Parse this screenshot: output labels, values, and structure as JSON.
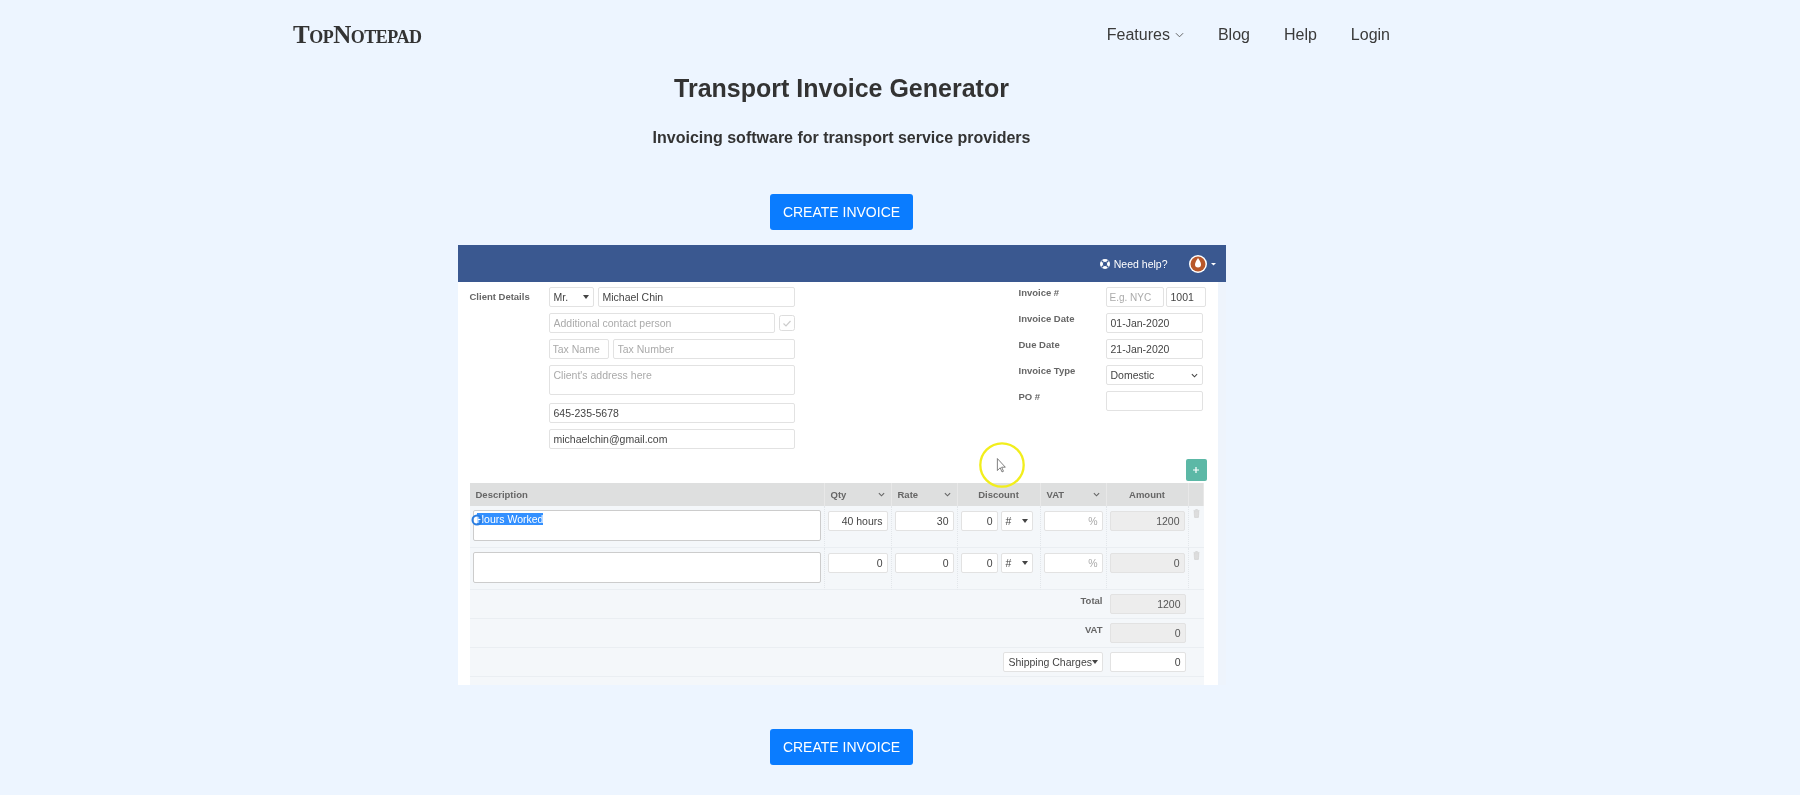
{
  "nav": {
    "logo": "TopNotepad",
    "items": [
      {
        "label": "Features",
        "dropdown": true
      },
      {
        "label": "Blog",
        "dropdown": false
      },
      {
        "label": "Help",
        "dropdown": false
      },
      {
        "label": "Login",
        "dropdown": false
      }
    ]
  },
  "hero": {
    "title": "Transport Invoice Generator",
    "subtitle": "Invoicing software for transport service providers"
  },
  "cta_top": "CREATE INVOICE",
  "app": {
    "help_label": "Need help?",
    "client": {
      "label": "Client Details",
      "salutation": "Mr.",
      "name": "Michael Chin",
      "contact_placeholder": "Additional contact person",
      "tax_name_placeholder": "Tax Name",
      "tax_number_placeholder": "Tax Number",
      "address_placeholder": "Client's address here",
      "phone": "645-235-5678",
      "email": "michaelchin@gmail.com"
    },
    "invoice_fields": [
      {
        "label": "Invoice #",
        "kind": "prefix",
        "placeholder": "E.g. NYC",
        "value": "1001"
      },
      {
        "label": "Invoice Date",
        "kind": "text",
        "value": "01-Jan-2020"
      },
      {
        "label": "Due Date",
        "kind": "text",
        "value": "21-Jan-2020"
      },
      {
        "label": "Invoice Type",
        "kind": "select",
        "value": "Domestic"
      },
      {
        "label": "PO #",
        "kind": "text"
      }
    ],
    "columns": [
      {
        "label": "Description",
        "menu": false
      },
      {
        "label": "Qty",
        "menu": true
      },
      {
        "label": "Rate",
        "menu": true
      },
      {
        "label": "Discount",
        "menu": false
      },
      {
        "label": "VAT",
        "menu": true
      },
      {
        "label": "Amount",
        "menu": false
      }
    ],
    "rows": [
      {
        "description": "Hours Worked",
        "text_selected": true,
        "qty": "40 hours",
        "rate": "30",
        "discount": "0",
        "discount_unit": "#",
        "vat_placeholder": "%",
        "amount": "1200"
      },
      {
        "text_selected": false,
        "qty": "0",
        "rate": "0",
        "discount": "0",
        "discount_unit": "#",
        "vat_placeholder": "%",
        "amount": "0"
      }
    ],
    "totals": [
      {
        "label": "Total",
        "kind": "readonly",
        "value": "1200"
      },
      {
        "label": "VAT",
        "kind": "readonly",
        "value": "0"
      },
      {
        "label": "Shipping Charges",
        "kind": "select",
        "value": "0"
      }
    ]
  },
  "cta_bottom": "CREATE INVOICE"
}
